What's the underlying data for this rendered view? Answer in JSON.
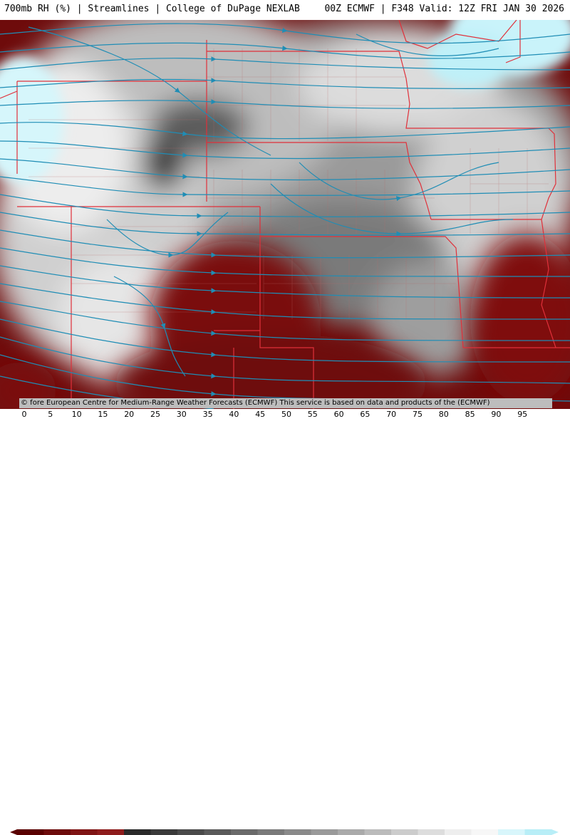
{
  "title": {
    "left": "700mb RH (%) | Streamlines | College of DuPage NEXLAB",
    "right": "00Z ECMWF | F348 Valid: 12Z FRI JAN 30 2026"
  },
  "credit": "© fore European Centre for Medium-Range Weather Forecasts (ECMWF)  This service is based on data and products of the (ECMWF)",
  "legend": {
    "ticks": [
      "0",
      "5",
      "10",
      "15",
      "20",
      "25",
      "30",
      "35",
      "40",
      "45",
      "50",
      "55",
      "60",
      "65",
      "70",
      "75",
      "80",
      "85",
      "90",
      "95"
    ],
    "colors": [
      "#5a0000",
      "#6d0b0b",
      "#7f1414",
      "#8e1c1c",
      "#2a2a2a",
      "#3a3a3a",
      "#4a4a4a",
      "#5a5a5a",
      "#6a6a6a",
      "#7a7a7a",
      "#8a8a8a",
      "#9a9a9a",
      "#aaaaaa",
      "#bbbbbb",
      "#cccccc",
      "#dddddd",
      "#eeeeee",
      "#f7f7f7",
      "#d8f6fb",
      "#b8eef7"
    ]
  },
  "colors": {
    "streamline": "#1f8db5",
    "state_border": "#e0303a",
    "county_border": "#c07070",
    "dry": "#7a0d0d",
    "moist": "#f2f2f2",
    "saturated": "#c9f3fa"
  }
}
